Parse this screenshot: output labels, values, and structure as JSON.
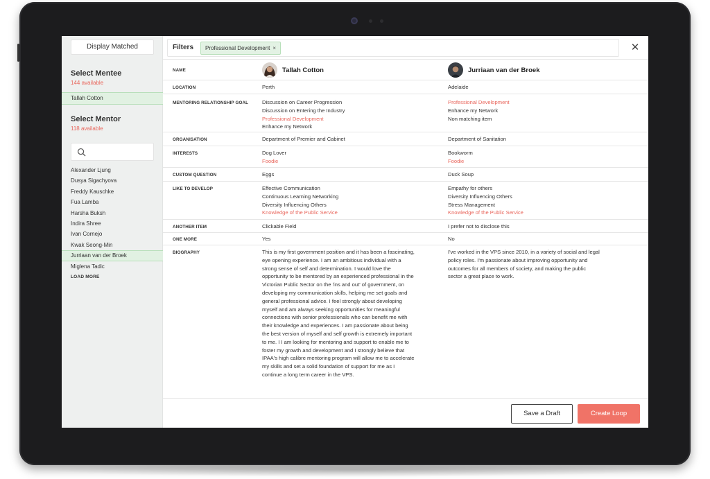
{
  "sidebar": {
    "display_matched_label": "Display Matched",
    "mentee_title": "Select Mentee",
    "mentee_available": "144 available",
    "selected_mentee": "Tallah Cotton",
    "mentor_title": "Select Mentor",
    "mentor_available": "118 available",
    "search_placeholder": "",
    "mentors": [
      "Alexander Ljung",
      "Dusya Sigachyova",
      "Freddy Kauschke",
      "Fua Lamba",
      "Harsha Buksh",
      "Indira Shree",
      "Ivan Cornejo",
      "Kwak Seong-Min",
      "Jurriaan van der Broek",
      "Miglena Tadic"
    ],
    "selected_mentor_index": 8,
    "load_more_label": "LOAD MORE"
  },
  "header": {
    "filters_label": "Filters",
    "filter_chip": "Professional Development",
    "chip_remove": "×",
    "close": "✕"
  },
  "table": {
    "name_label": "NAME",
    "mentee_name": "Tallah Cotton",
    "mentor_name": "Jurriaan van der Broek",
    "location_label": "LOCATION",
    "mentee_location": "Perth",
    "mentor_location": "Adelaide",
    "goal_label": "MENTORING RELATIONSHIP GOAL",
    "mentee_goals": [
      {
        "text": "Discussion on Career Progression",
        "highlight": false
      },
      {
        "text": "Discussion on Entering the Industry",
        "highlight": false
      },
      {
        "text": "Professional Development",
        "highlight": true
      },
      {
        "text": "Enhance my Network",
        "highlight": false
      }
    ],
    "mentor_goals": [
      {
        "text": "Professional Development",
        "highlight": true
      },
      {
        "text": "Enhance my Network",
        "highlight": false
      },
      {
        "text": "Non matching item",
        "highlight": false
      }
    ],
    "organisation_label": "ORGANISATION",
    "mentee_organisation": "Department of Premier and Cabinet",
    "mentor_organisation": "Department of Sanitation",
    "interests_label": "INTERESTS",
    "mentee_interests": [
      {
        "text": "Dog Lover",
        "highlight": false
      },
      {
        "text": "Foodie",
        "highlight": true
      }
    ],
    "mentor_interests": [
      {
        "text": "Bookworm",
        "highlight": false
      },
      {
        "text": "Foodie",
        "highlight": true
      }
    ],
    "custom_question_label": "CUSTOM QUESTION",
    "mentee_custom": "Eggs",
    "mentor_custom": "Duck Soup",
    "develop_label": "LIKE TO DEVELOP",
    "mentee_develop": [
      {
        "text": "Effective Communication",
        "highlight": false
      },
      {
        "text": "Continuous Learning Networking",
        "highlight": false
      },
      {
        "text": "Diversity Influencing Others",
        "highlight": false
      },
      {
        "text": "Knowledge of the Public Service",
        "highlight": true
      }
    ],
    "mentor_develop": [
      {
        "text": "Empathy for others",
        "highlight": false
      },
      {
        "text": "Diversity Influencing Others",
        "highlight": false
      },
      {
        "text": "Stress Management",
        "highlight": false
      },
      {
        "text": "Knowledge of the Public Service",
        "highlight": true
      }
    ],
    "another_item_label": "ANOTHER ITEM",
    "mentee_another": "Clickable Field",
    "mentor_another": "I prefer not to disclose this",
    "one_more_label": "ONE MORE",
    "mentee_one_more": "Yes",
    "mentor_one_more": "No",
    "biography_label": "BIOGRAPHY",
    "mentee_bio_lines": [
      "This is my first government position and it has been a fascinating,",
      "eye opening experience. I am an ambitious individual with a",
      "strong sense of self and determination. I would love the",
      "opportunity to be mentored by an experienced professional in the",
      "Victorian Public Sector on the 'ins and out' of government, on",
      "developing my communication skills, helping me set goals and",
      "general professional advice. I feel strongly about developing",
      "myself and am always seeking opportunities for meaningful",
      "connections with senior professionals who can benefit me with",
      "their knowledge and experiences. I am passionate about being",
      "the best version of myself and self growth is extremely important",
      "to me. I I am looking for mentoring and support to enable me to",
      "foster my growth and development and I strongly believe that",
      "IPAA's high calibre mentoring program will allow me to accelerate",
      "my skills and set a solid foundation of support for me as I",
      "continue a long term career in the VPS."
    ],
    "mentor_bio_lines": [
      "I've worked in the VPS since 2010, in a variety of social and legal",
      "policy roles. I'm passionate about improving opportunity and",
      "outcomes for all members of society, and making the public",
      "sector a great place to work."
    ]
  },
  "footer": {
    "save_draft_label": "Save a Draft",
    "create_loop_label": "Create Loop"
  },
  "colors": {
    "accent": "#f07367",
    "highlight_text": "#e9675d",
    "selected_bg": "#e1f1e2",
    "chip_bg": "#e3f2e4"
  }
}
